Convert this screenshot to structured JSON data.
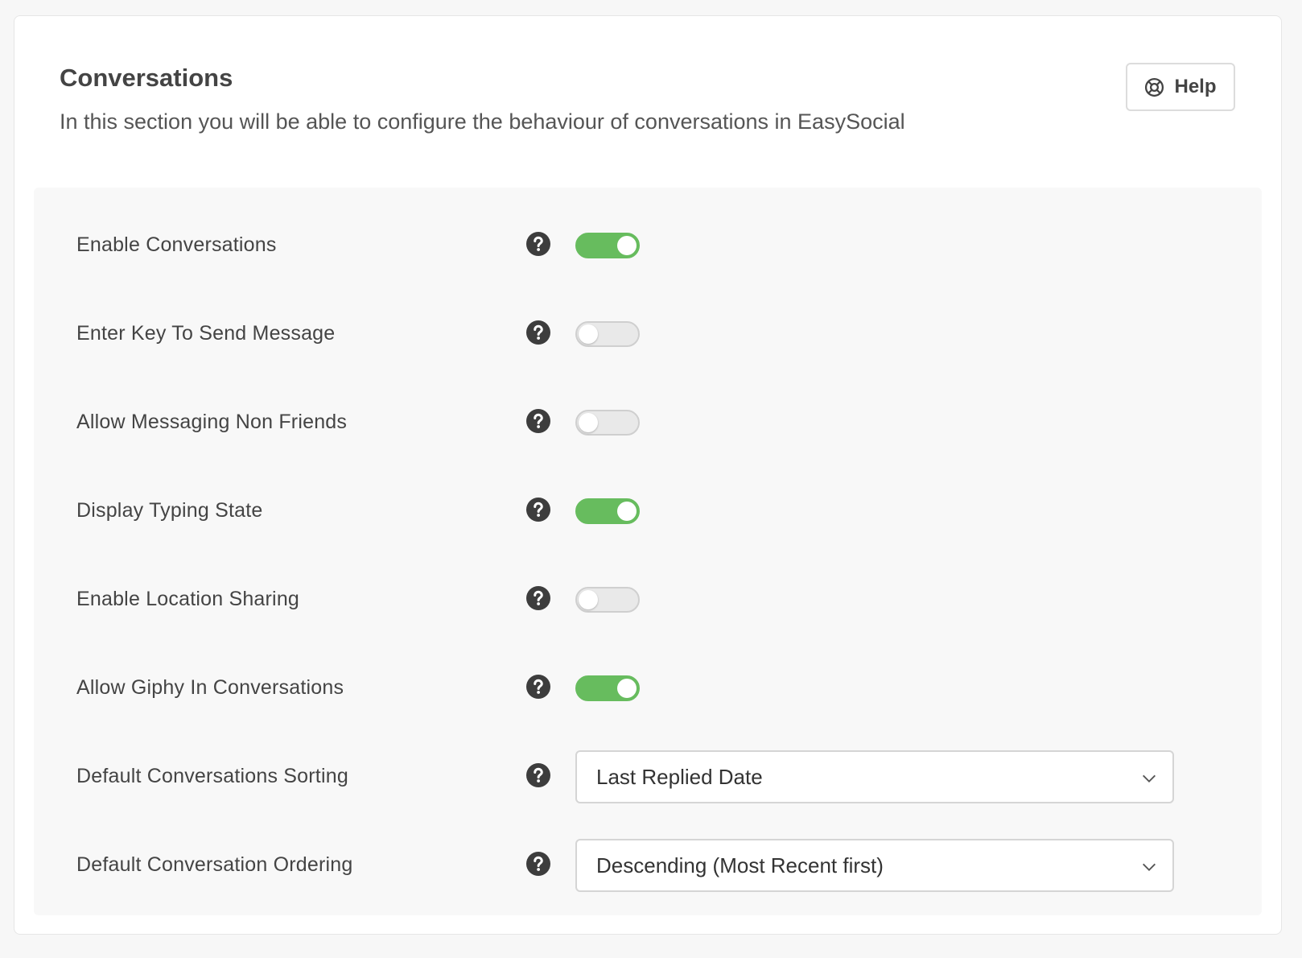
{
  "header": {
    "title": "Conversations",
    "description": "In this section you will be able to configure the behaviour of conversations in EasySocial",
    "help_label": "Help"
  },
  "settings": [
    {
      "label": "Enable Conversations",
      "type": "toggle",
      "on": true
    },
    {
      "label": "Enter Key To Send Message",
      "type": "toggle",
      "on": false
    },
    {
      "label": "Allow Messaging Non Friends",
      "type": "toggle",
      "on": false
    },
    {
      "label": "Display Typing State",
      "type": "toggle",
      "on": true
    },
    {
      "label": "Enable Location Sharing",
      "type": "toggle",
      "on": false
    },
    {
      "label": "Allow Giphy In Conversations",
      "type": "toggle",
      "on": true
    },
    {
      "label": "Default Conversations Sorting",
      "type": "select",
      "value": "Last Replied Date"
    },
    {
      "label": "Default Conversation Ordering",
      "type": "select",
      "value": "Descending (Most Recent first)"
    }
  ],
  "colors": {
    "toggle_on": "#67bc5e",
    "toggle_off": "#e9e9e9"
  },
  "icons": {
    "help": "lifebuoy-icon",
    "tooltip": "question-circle-icon",
    "dropdown": "chevron-down-icon"
  }
}
